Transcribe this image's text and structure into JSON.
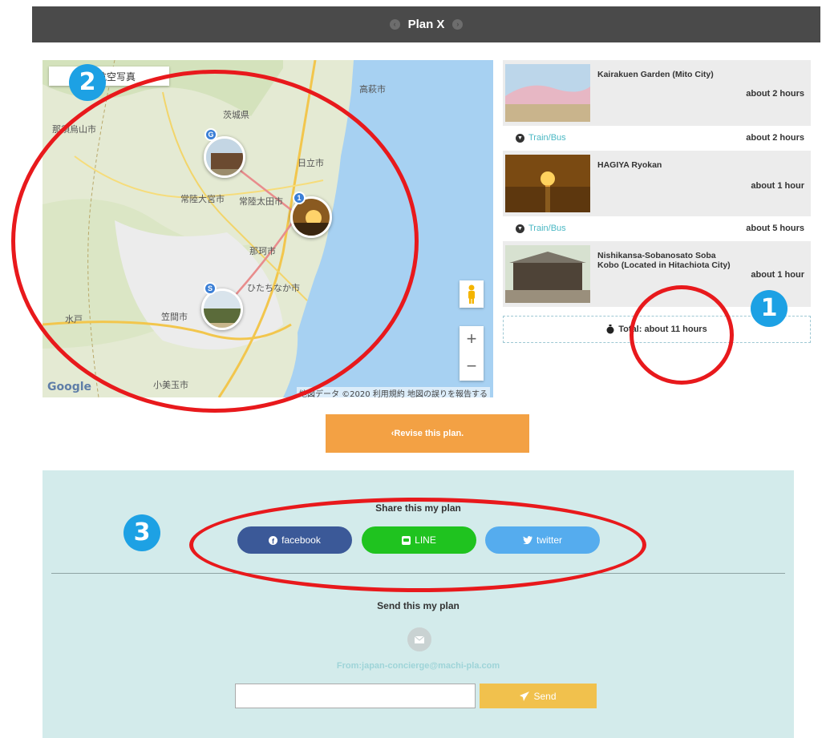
{
  "header": {
    "title": "Plan X",
    "prev_icon": "chevron-left-icon",
    "next_icon": "chevron-right-icon",
    "background": "#4a4a4a"
  },
  "map": {
    "map_type_label": "航空写真",
    "labels": {
      "takahagi": "高萩市",
      "ibaraki": "茨城県",
      "hitachi": "日立市",
      "hitachiomiya": "常陸大宮市",
      "hitachiota": "常陸太田市",
      "naka": "那珂市",
      "hitachinaka": "ひたちなか市",
      "kasama": "笠間市",
      "omitama": "小美玉市",
      "nasukarasuyama": "那須烏山市",
      "mito": "水戸"
    },
    "markers": {
      "goal": "G",
      "start": "S",
      "num1": "1"
    },
    "google_logo": "Google",
    "attribution": "地図データ ©2020  利用規約  地図の誤りを報告する",
    "zoom_in": "+",
    "zoom_out": "−"
  },
  "itinerary": {
    "spots": [
      {
        "name": "Kairakuen Garden (Mito City)",
        "duration": "about 2 hours"
      },
      {
        "name": "HAGIYA Ryokan",
        "duration": "about 1 hour"
      },
      {
        "name": "Nishikansa-Sobanosato Soba Kobo (Located in Hitachiota City)",
        "duration": "about 1 hour"
      }
    ],
    "transits": [
      {
        "mode": "Train/Bus",
        "duration": "about 2 hours"
      },
      {
        "mode": "Train/Bus",
        "duration": "about 5 hours"
      }
    ],
    "total": "Total: about 11 hours"
  },
  "revise_button": "Revise this plan.",
  "share": {
    "heading": "Share this my plan",
    "facebook": "facebook",
    "line": "LINE",
    "twitter": "twitter",
    "colors": {
      "facebook": "#3b5998",
      "line": "#1fc31f",
      "twitter": "#55acee"
    }
  },
  "send": {
    "heading": "Send this my plan",
    "from": "From:japan-concierge@machi-pla.com",
    "email_value": "",
    "button": "Send"
  },
  "annotations": {
    "badge1": "1",
    "badge2": "2",
    "badge3": "3",
    "ring_color": "#e8191c",
    "badge_color": "#1da1e4"
  }
}
